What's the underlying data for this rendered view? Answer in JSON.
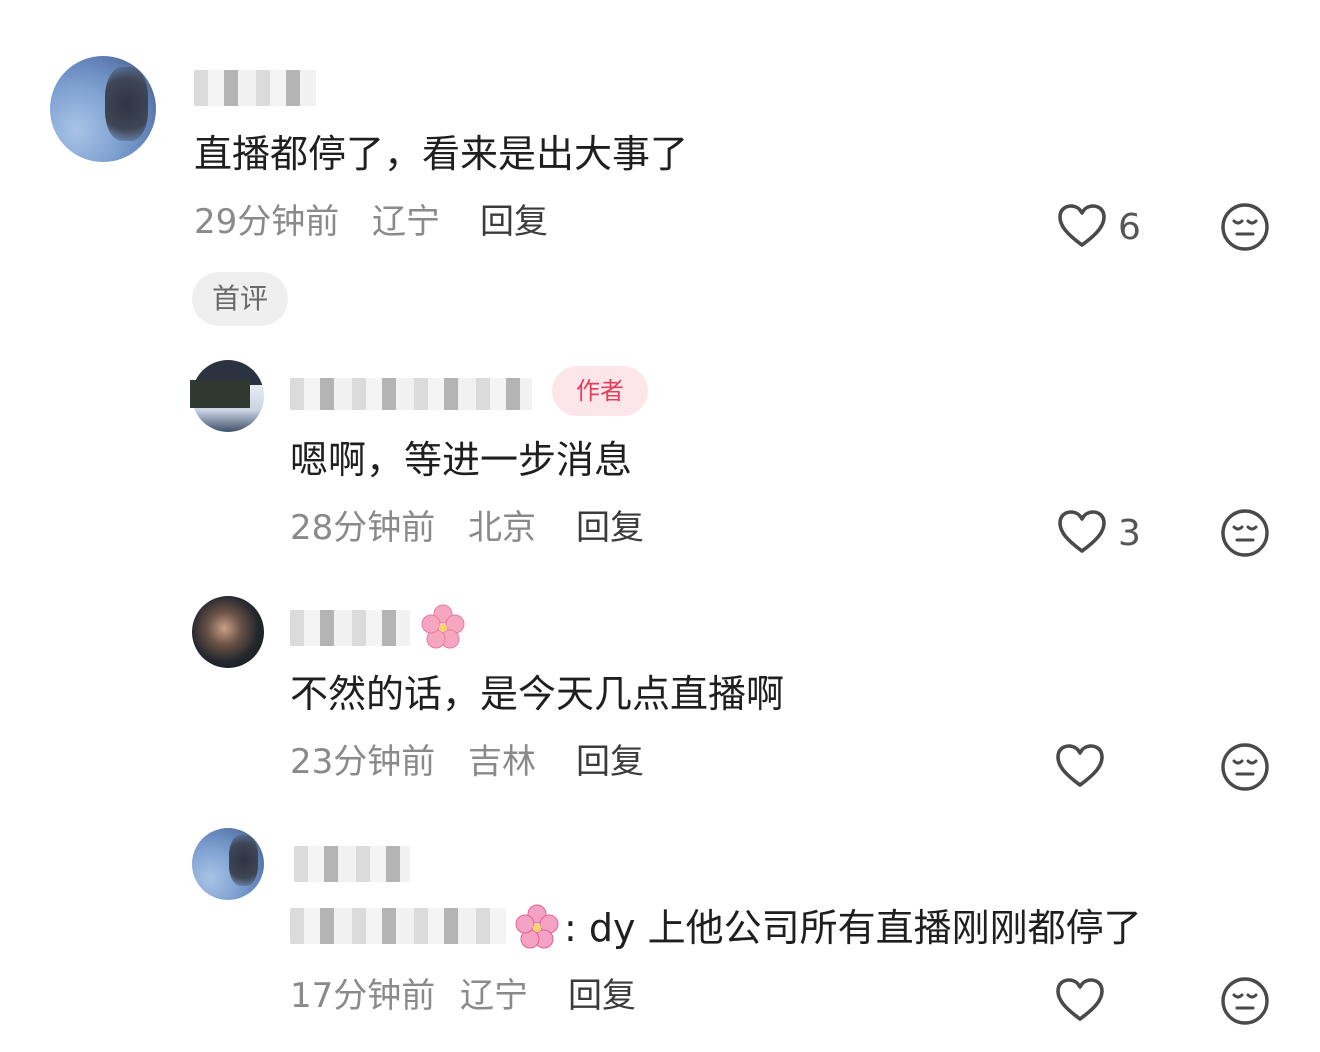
{
  "comments": [
    {
      "body": "直播都停了，看来是出大事了",
      "time": "29分钟前",
      "location": "辽宁",
      "reply_label": "回复",
      "likes": "6",
      "badge": "首评"
    },
    {
      "body": "嗯啊，等进一步消息",
      "time": "28分钟前",
      "location": "北京",
      "reply_label": "回复",
      "likes": "3",
      "author_badge": "作者"
    },
    {
      "body": "不然的话，是今天几点直播啊",
      "time": "23分钟前",
      "location": "吉林",
      "reply_label": "回复",
      "likes": ""
    },
    {
      "body": ": dy 上他公司所有直播刚刚都停了",
      "time": "17分钟前",
      "location": "辽宁",
      "reply_label": "回复",
      "likes": ""
    }
  ],
  "icons": {
    "like": "heart-outline-icon",
    "dislike": "neutral-face-icon",
    "flower": "cherry-blossom-icon"
  },
  "colors": {
    "text_primary": "#1f1f1f",
    "text_meta": "#8a8a8a",
    "badge_bg": "#efefef",
    "author_badge_bg": "#fde6ea",
    "author_badge_text": "#e0405e"
  }
}
